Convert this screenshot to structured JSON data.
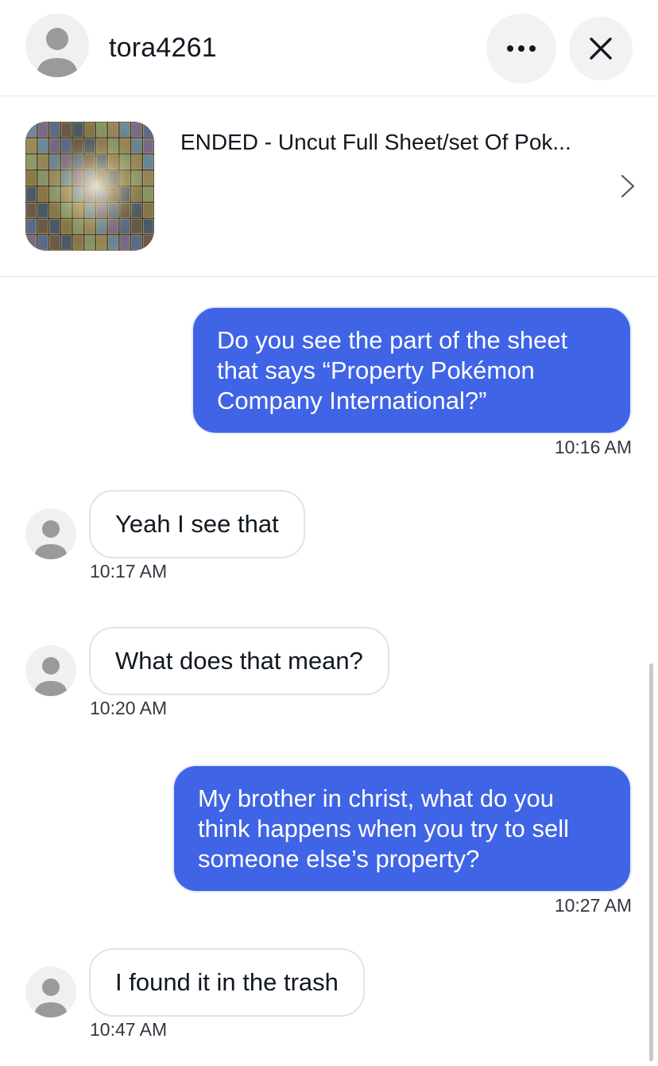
{
  "header": {
    "username": "tora4261",
    "more_icon": "more-horizontal-icon",
    "close_icon": "close-icon"
  },
  "listing": {
    "title": "ENDED - Uncut Full Sheet/set Of Pok...",
    "chevron_icon": "chevron-right-icon"
  },
  "messages": [
    {
      "from": "me",
      "text": "Do you see the part of the sheet that says “Property Pokémon Company International?”",
      "time": "10:16 AM"
    },
    {
      "from": "them",
      "text": "Yeah I see that",
      "time": "10:17 AM"
    },
    {
      "from": "them",
      "text": "What does that mean?",
      "time": "10:20 AM"
    },
    {
      "from": "me",
      "text": "My brother in christ, what do you think happens when you try to sell someone else’s property?",
      "time": "10:27 AM"
    },
    {
      "from": "them",
      "text": "I found it in the trash",
      "time": "10:47 AM"
    }
  ],
  "colors": {
    "outgoing_bubble": "#3f64e6",
    "incoming_border": "#e3e3e3",
    "avatar_bg": "#f0f0f0",
    "avatar_fg": "#9a9a9a"
  }
}
